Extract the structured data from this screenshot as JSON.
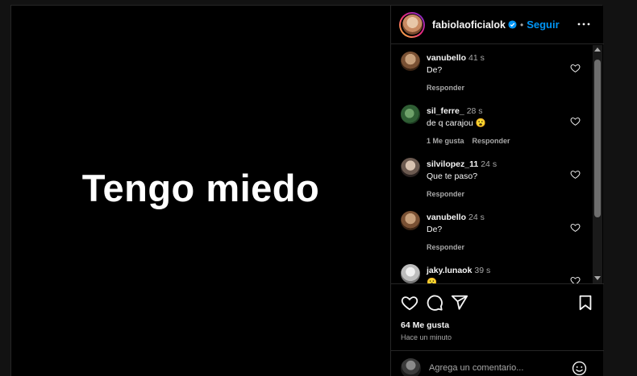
{
  "post": {
    "text": "Tengo miedo"
  },
  "header": {
    "username": "fabiolaoficialok",
    "separator": "•",
    "follow_label": "Seguir",
    "more_icon": "more-options-icon",
    "verified_icon": "verified-badge-icon"
  },
  "comments": [
    {
      "user": "vanubello",
      "time": "41 s",
      "text": "De?",
      "likes": "",
      "reply": "Responder",
      "avatar": "avatar-vanubello"
    },
    {
      "user": "sil_ferre_",
      "time": "28 s",
      "text": "de q carajou 😮",
      "likes": "1 Me gusta",
      "reply": "Responder",
      "avatar": "avatar-sil-ferre"
    },
    {
      "user": "silvilopez_11",
      "time": "24 s",
      "text": "Que te paso?",
      "likes": "",
      "reply": "Responder",
      "avatar": "avatar-silvilopez"
    },
    {
      "user": "vanubello",
      "time": "24 s",
      "text": "De?",
      "likes": "",
      "reply": "Responder",
      "avatar": "avatar-vanubello"
    },
    {
      "user": "jaky.lunaok",
      "time": "39 s",
      "text": "😮",
      "likes": "",
      "reply": "",
      "avatar": "avatar-jaky"
    }
  ],
  "actions": {
    "likes_label": "64 Me gusta",
    "time_ago": "Hace un minuto",
    "icons": [
      "like-heart-icon",
      "comment-icon",
      "share-icon",
      "save-bookmark-icon"
    ]
  },
  "add_comment": {
    "placeholder": "Agrega un comentario...",
    "emoji_icon": "emoji-icon"
  },
  "colors": {
    "accent": "#0095f6",
    "background": "#000000",
    "muted": "#a8a8a8",
    "divider": "#262626"
  }
}
